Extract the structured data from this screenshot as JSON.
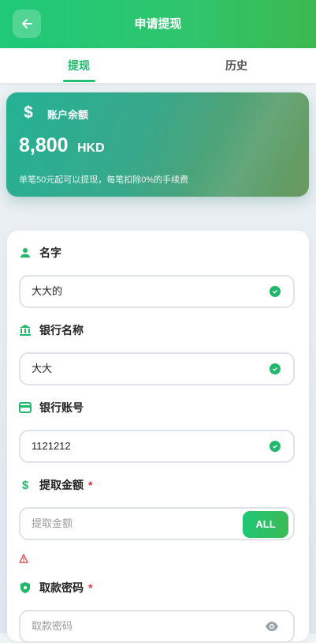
{
  "header": {
    "title": "申请提现",
    "back_icon": "arrow-left-icon"
  },
  "tabs": [
    {
      "label": "提现",
      "active": true
    },
    {
      "label": "历史",
      "active": false
    }
  ],
  "balance": {
    "label": "账户余额",
    "amount": "8,800",
    "currency": "HKD",
    "note": "单笔50元起可以提现，每笔扣除0%的手续费",
    "icon": "dollar-icon"
  },
  "form": {
    "name": {
      "label": "名字",
      "value": "大大的",
      "icon": "person-icon"
    },
    "bank_name": {
      "label": "银行名称",
      "value": "大大",
      "icon": "bank-icon"
    },
    "bank_account": {
      "label": "银行账号",
      "value": "1121212",
      "icon": "card-icon"
    },
    "amount": {
      "label": "提取金额",
      "required": "*",
      "placeholder": "提取金额",
      "all_button": "ALL",
      "icon": "dollar-icon"
    },
    "password": {
      "label": "取款密码",
      "required": "*",
      "placeholder": "取款密码",
      "icon": "shield-icon"
    }
  },
  "colors": {
    "accent": "#21b86a",
    "required": "#e0343d"
  }
}
